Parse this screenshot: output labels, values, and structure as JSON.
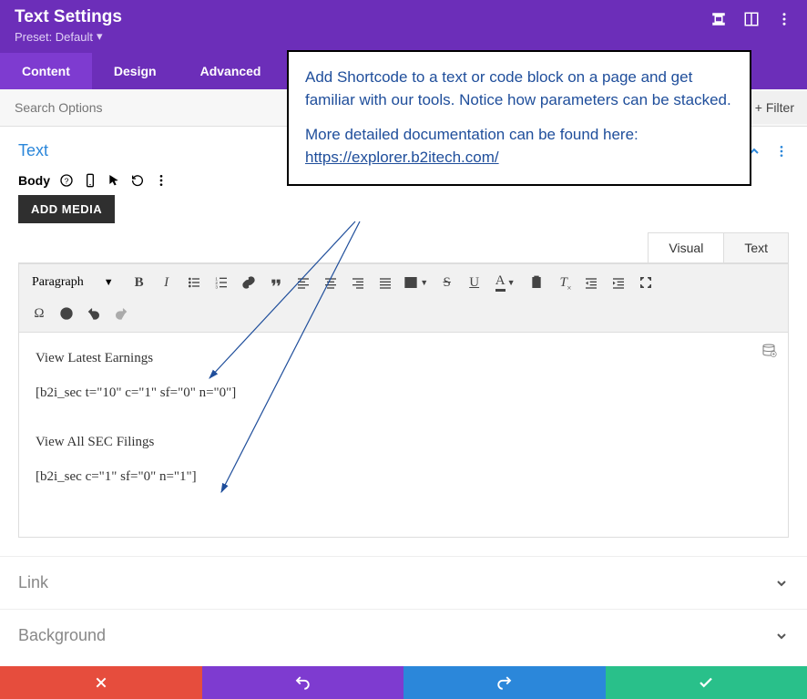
{
  "header": {
    "title": "Text Settings",
    "preset_label": "Preset: Default"
  },
  "tabs": [
    "Content",
    "Design",
    "Advanced"
  ],
  "active_tab": 0,
  "search_placeholder": "Search Options",
  "filter_label": "Filter",
  "section_text": {
    "title": "Text",
    "body_label": "Body",
    "add_media_label": "ADD MEDIA"
  },
  "editor_tabs": {
    "visual": "Visual",
    "text": "Text",
    "active": "Visual"
  },
  "paragraph_label": "Paragraph",
  "editor_content": {
    "p1": "View Latest Earnings",
    "p2": "[b2i_sec t=\"10\" c=\"1\" sf=\"0\" n=\"0\"]",
    "p3": "View All SEC Filings",
    "p4": "[b2i_sec  c=\"1\" sf=\"0\" n=\"1\"]"
  },
  "accordions": {
    "link": "Link",
    "background": "Background"
  },
  "callout": {
    "p1": "Add Shortcode to a text or code block on a page and get familiar with our tools.   Notice how parameters can be stacked.",
    "p2": "More detailed documentation can be found here:",
    "url": "https://explorer.b2itech.com/"
  }
}
